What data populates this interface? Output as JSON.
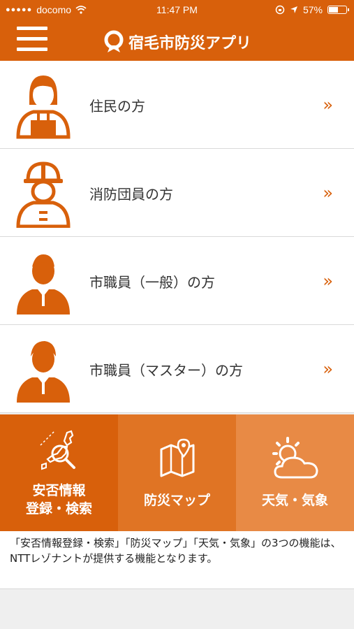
{
  "status_bar": {
    "carrier": "docomo",
    "time": "11:47 PM",
    "battery": "57%",
    "battery_level": 0.57
  },
  "header": {
    "title": "宿毛市防災アプリ"
  },
  "user_types": [
    {
      "label": "住民の方",
      "chevron": "»"
    },
    {
      "label": "消防団員の方",
      "chevron": "»"
    },
    {
      "label": "市職員（一般）の方",
      "chevron": "»"
    },
    {
      "label": "市職員（マスター）の方",
      "chevron": "»"
    }
  ],
  "tiles": [
    {
      "line1": "安否情報",
      "line2": "登録・検索",
      "color": "#d8600b"
    },
    {
      "line1": "防災マップ",
      "color": "#e07424"
    },
    {
      "line1": "天気・気象",
      "color": "#e88a45"
    }
  ],
  "footer_note": "「安否情報登録・検索」「防災マップ」「天気・気象」の3つの機能は、NTTレゾナントが提供する機能となります。",
  "colors": {
    "accent": "#d8600b"
  }
}
